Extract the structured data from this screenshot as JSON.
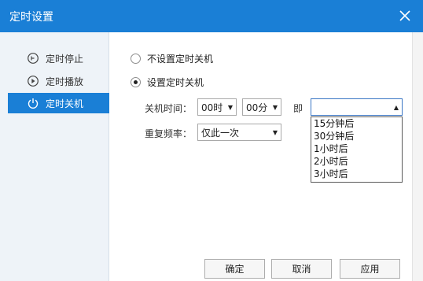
{
  "window": {
    "title": "定时设置"
  },
  "sidebar": {
    "items": [
      {
        "label": "定时停止",
        "icon": "timer-stop-icon"
      },
      {
        "label": "定时播放",
        "icon": "timer-play-icon"
      },
      {
        "label": "定时关机",
        "icon": "power-icon"
      }
    ],
    "active_index": 2
  },
  "options": {
    "no_shutdown": "不设置定时关机",
    "set_shutdown": "设置定时关机"
  },
  "form": {
    "time_label": "关机时间：",
    "hour_value": "00时",
    "minute_value": "00分",
    "immediate_label": "即",
    "after_value": "",
    "after_options": [
      "15分钟后",
      "30分钟后",
      "1小时后",
      "2小时后",
      "3小时后"
    ],
    "repeat_label": "重复频率：",
    "repeat_value": "仅此一次"
  },
  "buttons": {
    "ok": "确定",
    "cancel": "取消",
    "apply": "应用"
  },
  "colors": {
    "accent": "#1a7fd6",
    "background": "#ffffff",
    "sidebar": "#eef3f8"
  }
}
